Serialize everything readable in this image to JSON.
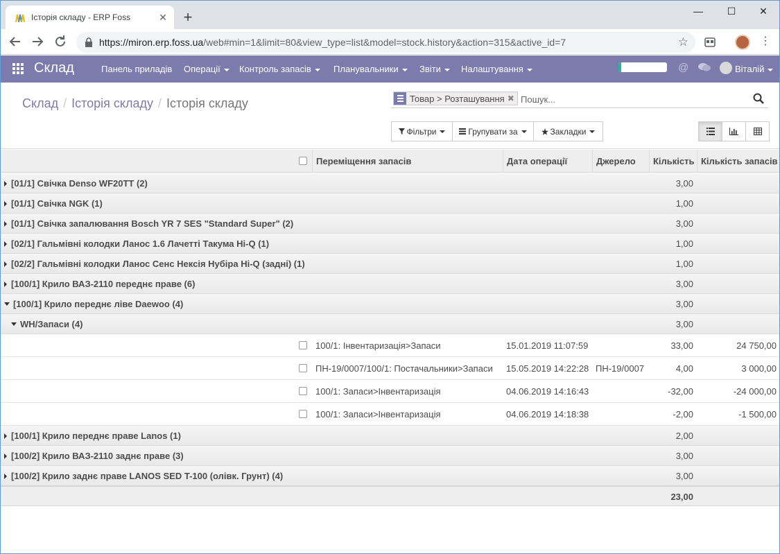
{
  "browser": {
    "tab_title": "Історія складу - ERP Foss",
    "tab_close": "✕",
    "new_tab": "+",
    "url_host": "https://miron.erp.foss.ua",
    "url_rest": "/web#min=1&limit=80&view_type=list&model=stock.history&action=315&active_id=7",
    "star": "☆",
    "kebab": "⋮",
    "win_min": "—",
    "win_max": "☐",
    "win_close": "✕"
  },
  "navbar": {
    "app_name": "Склад",
    "menus": [
      "Панель приладів",
      "Операції",
      "Контроль запасів",
      "Планувальники",
      "Звіти",
      "Налаштування"
    ],
    "progress_fraction": 0.05,
    "at_symbol": "@",
    "user": "Віталій"
  },
  "breadcrumb": {
    "items": [
      "Склад",
      "Історія складу",
      "Історія складу"
    ],
    "separator": "/"
  },
  "search": {
    "facet_label": "Товар > Розташування",
    "facet_remove": "✖",
    "placeholder": "Пошук..."
  },
  "buttons": {
    "filters": "Фільтри",
    "group_by": "Групувати за",
    "favorites": "Закладки"
  },
  "table": {
    "columns": [
      "Переміщення запасів",
      "Дата операції",
      "Джерело",
      "Кількість",
      "Кількість запасів"
    ],
    "groups_before": [
      {
        "label": "[01/1] Свічка Denso WF20TT (2)",
        "qty": "3,00"
      },
      {
        "label": "[01/1] Свічка NGK (1)",
        "qty": "1,00"
      },
      {
        "label": "[01/1] Свічка запалювання Bosch YR 7 SES \"Standard Super\" (2)",
        "qty": "3,00"
      },
      {
        "label": "[02/1] Гальмівні колодки Ланос 1.6 Лачетті Такума Hi-Q (1)",
        "qty": "1,00"
      },
      {
        "label": "[02/2] Гальмівні колодки Ланос Сенс Нексія Нубіра Hi-Q (задні) (1)",
        "qty": "1,00"
      },
      {
        "label": "[100/1] Крило ВАЗ-2110 переднє праве (6)",
        "qty": "3,00"
      }
    ],
    "open_group": {
      "label": "[100/1] Крило переднє ліве Daewoo (4)",
      "qty": "3,00"
    },
    "open_subgroup": {
      "label": "WH/Запаси (4)",
      "qty": "3,00"
    },
    "records": [
      {
        "move": "100/1: Інвентаризація>Запаси",
        "date": "15.01.2019 11:07:59",
        "source": "",
        "qty": "33,00",
        "stock_qty": "24 750,00"
      },
      {
        "move": "ПН-19/0007/100/1: Постачальники>Запаси",
        "date": "15.05.2019 14:22:28",
        "source": "ПН-19/0007",
        "qty": "4,00",
        "stock_qty": "3 000,00"
      },
      {
        "move": "100/1: Запаси>Інвентаризація",
        "date": "04.06.2019 14:16:43",
        "source": "",
        "qty": "-32,00",
        "stock_qty": "-24 000,00"
      },
      {
        "move": "100/1: Запаси>Інвентаризація",
        "date": "04.06.2019 14:18:38",
        "source": "",
        "qty": "-2,00",
        "stock_qty": "-1 500,00"
      }
    ],
    "groups_after": [
      {
        "label": "[100/1] Крило переднє праве Lanos (1)",
        "qty": "2,00"
      },
      {
        "label": "[100/2] Крило ВАЗ-2110 заднє праве (3)",
        "qty": "3,00"
      },
      {
        "label": "[100/2] Крило заднє праве LANOS SED T-100 (олівк. Грунт) (4)",
        "qty": "3,00"
      }
    ],
    "total_qty": "23,00"
  },
  "colors": {
    "brand": "#7c7bad",
    "progress": "#21b799"
  }
}
